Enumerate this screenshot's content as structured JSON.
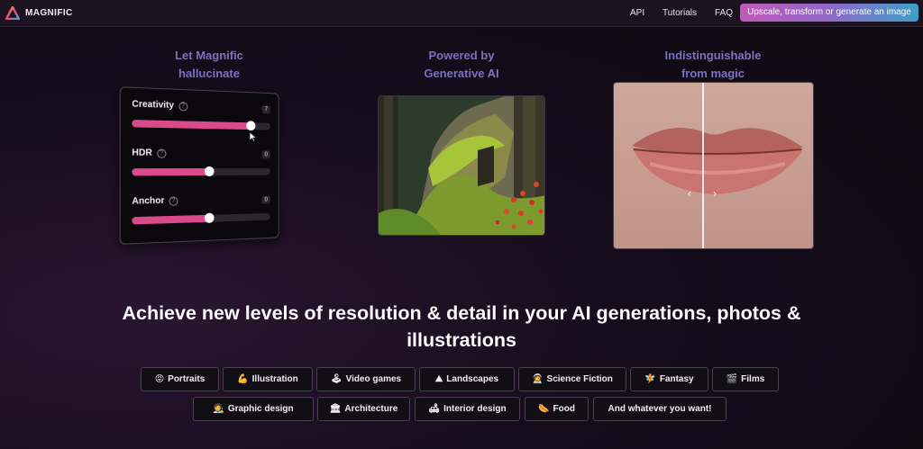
{
  "nav": {
    "brand": "MAGNIFIC",
    "links": [
      "API",
      "Tutorials",
      "FAQ"
    ],
    "cta": "Upscale, transform or generate an image"
  },
  "columns": [
    {
      "line1": "Let Magnific",
      "line2": "hallucinate"
    },
    {
      "line1": "Powered by",
      "line2": "Generative AI"
    },
    {
      "line1": "Indistinguishable",
      "line2": "from magic"
    }
  ],
  "controls": [
    {
      "label": "Creativity",
      "value": "7",
      "level": 0.85
    },
    {
      "label": "HDR",
      "value": "0",
      "level": 0.54
    },
    {
      "label": "Anchor",
      "value": "0",
      "level": 0.54
    }
  ],
  "headline": {
    "line1": "Achieve new levels of resolution & detail in your AI generations, photos &",
    "line2": "illustrations"
  },
  "categories": [
    {
      "icon": "😡",
      "label": "Portraits"
    },
    {
      "icon": "💪",
      "label": "Illustration"
    },
    {
      "icon": "🕹",
      "label": "Video games"
    },
    {
      "icon": "⛰",
      "label": "Landscapes"
    },
    {
      "icon": "🧑‍🚀",
      "label": "Science Fiction"
    },
    {
      "icon": "🧚",
      "label": "Fantasy"
    },
    {
      "icon": "🎬",
      "label": "Films"
    },
    {
      "icon": "🧑‍🎨",
      "label": "Graphic design"
    },
    {
      "icon": "🏛",
      "label": "Architecture"
    },
    {
      "icon": "🛋",
      "label": "Interior design"
    },
    {
      "icon": "🌭",
      "label": "Food"
    },
    {
      "icon": "",
      "label": "And whatever you want!"
    }
  ],
  "colors": {
    "accent_pink": "#d94a8c",
    "cta_start": "#c05ab8",
    "cta_end": "#3f9fc8"
  }
}
